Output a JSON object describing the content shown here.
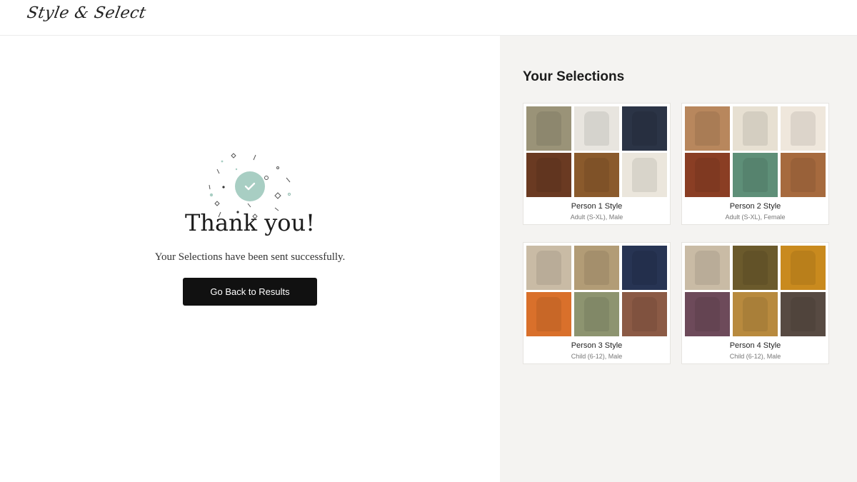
{
  "header": {
    "logo": "Style & Select"
  },
  "confirmation": {
    "title": "Thank you!",
    "message": "Your Selections have been sent successfully.",
    "button_label": "Go Back to Results"
  },
  "selections": {
    "title": "Your Selections",
    "cards": [
      {
        "name": "Person 1 Style",
        "sub": "Adult (S-XL), Male",
        "items": [
          "olive-shirt",
          "white-henley",
          "navy-jeans",
          "brown-jacket",
          "brown-boots",
          "striped-shirt"
        ],
        "colors": [
          "#9a9378",
          "#e8e5df",
          "#2b3446",
          "#6a3a22",
          "#8a5a2c",
          "#ebe6dc"
        ]
      },
      {
        "name": "Person 2 Style",
        "sub": "Adult (S-XL), Female",
        "items": [
          "tan-jumpsuit",
          "cream-outfit",
          "cream-top",
          "rust-dress",
          "green-skirt",
          "rust-maxi"
        ],
        "colors": [
          "#b8875d",
          "#e7e0d2",
          "#efe7dc",
          "#8a3e24",
          "#5e8f78",
          "#a66a3e"
        ]
      },
      {
        "name": "Person 3 Style",
        "sub": "Child (6-12), Male",
        "items": [
          "beige-sweater",
          "khaki-shorts",
          "navy-jeans",
          "orange-tee",
          "green-pants",
          "plaid-shirt"
        ],
        "colors": [
          "#c9bba5",
          "#b29c76",
          "#273453",
          "#d9702b",
          "#8d9470",
          "#8b5a45"
        ]
      },
      {
        "name": "Person 4 Style",
        "sub": "Child (6-12), Male",
        "items": [
          "beige-sweater",
          "olive-cardigan",
          "mustard-pants",
          "plum-top",
          "tan-shorts",
          "brown-longsleeve"
        ],
        "colors": [
          "#c9bba5",
          "#6b5a2c",
          "#c98a1e",
          "#6d4a5a",
          "#b88a3e",
          "#574a42"
        ]
      }
    ]
  }
}
